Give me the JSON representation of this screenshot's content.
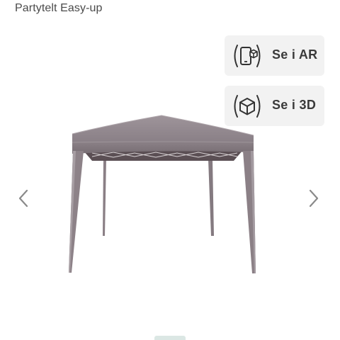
{
  "product": {
    "title": "Partytelt Easy-up"
  },
  "view_buttons": {
    "ar_label": "Se i AR",
    "ar_icon": "phone-cube-icon",
    "d3_label": "Se i 3D",
    "d3_icon": "cube-icon"
  },
  "gallery": {
    "prev_icon": "chevron-left-icon",
    "next_icon": "chevron-right-icon",
    "image_subject": "gazebo-image"
  },
  "colors": {
    "button_bg": "#f2f2f2",
    "text": "#3a3a3a",
    "canopy": "#8d8287",
    "indicator": "#dbe7e4"
  }
}
